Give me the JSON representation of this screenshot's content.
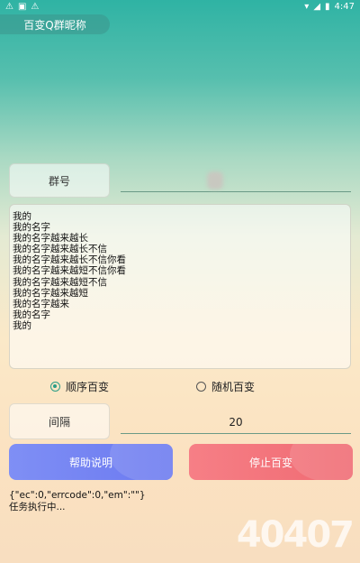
{
  "status_bar": {
    "time": "4:47"
  },
  "header": {
    "title": "百变Q群昵称"
  },
  "group": {
    "label": "群号",
    "value": ""
  },
  "content": {
    "lines": [
      "我的",
      "我的名字",
      "我的名字越来越长",
      "我的名字越来越长不信",
      "我的名字越来越长不信你看",
      "我的名字越来越短不信你看",
      "我的名字越来越短不信",
      "我的名字越来越短",
      "我的名字越来",
      "我的名字",
      "我的"
    ]
  },
  "mode": {
    "options": [
      {
        "label": "顺序百变",
        "checked": true
      },
      {
        "label": "随机百变",
        "checked": false
      }
    ]
  },
  "interval": {
    "label": "间隔",
    "value": "20"
  },
  "buttons": {
    "help": "帮助说明",
    "stop": "停止百变"
  },
  "log": {
    "line1": "{\"ec\":0,\"errcode\":0,\"em\":\"\"}",
    "line2": "任务执行中..."
  },
  "watermark": {
    "text": "40407"
  }
}
